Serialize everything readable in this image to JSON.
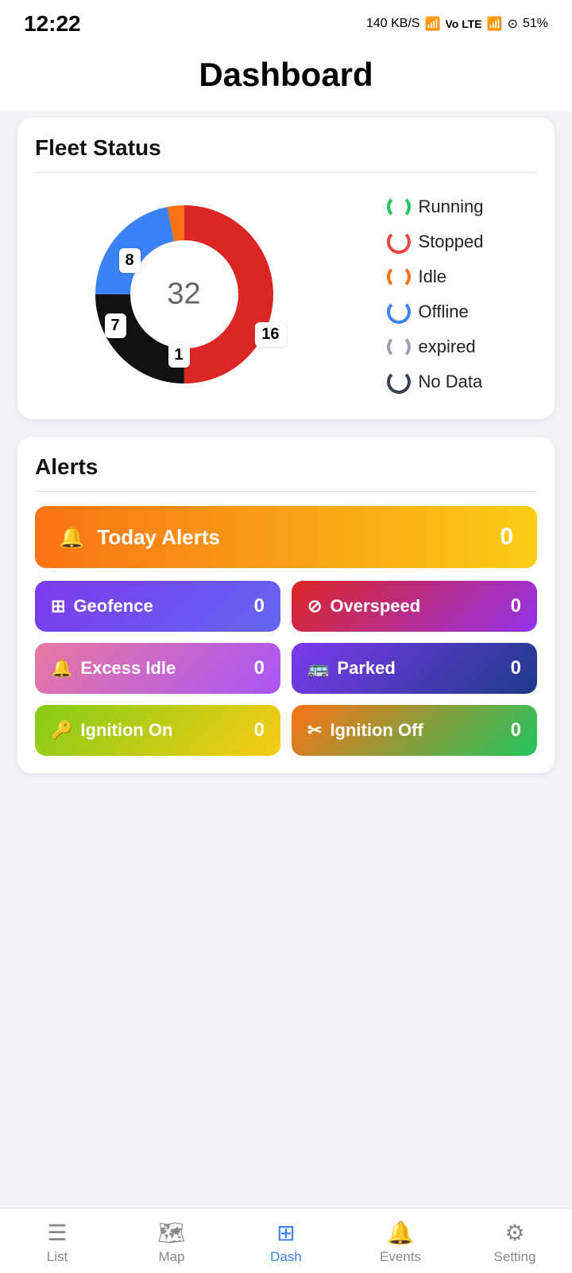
{
  "statusBar": {
    "time": "12:22",
    "networkSpeed": "140 KB/S",
    "battery": "51%"
  },
  "header": {
    "title": "Dashboard"
  },
  "fleetStatus": {
    "cardTitle": "Fleet Status",
    "totalVehicles": "32",
    "segments": [
      {
        "label": "Running",
        "value": 16,
        "color": "#dc2626",
        "legendClass": "spinner-running"
      },
      {
        "label": "Stopped",
        "value": 8,
        "color": "#111111",
        "legendClass": "spinner-stopped"
      },
      {
        "label": "Idle",
        "value": 1,
        "color": "#f97316",
        "legendClass": "spinner-idle"
      },
      {
        "label": "Offline",
        "value": 7,
        "color": "#3b82f6",
        "legendClass": "spinner-offline"
      },
      {
        "label": "expired",
        "value": 0,
        "color": "#9ca3af",
        "legendClass": "spinner-expired"
      },
      {
        "label": "No Data",
        "value": 0,
        "color": "#374151",
        "legendClass": "spinner-nodata"
      }
    ],
    "labels": [
      {
        "text": "8",
        "class": "label-8"
      },
      {
        "text": "16",
        "class": "label-16"
      },
      {
        "text": "7",
        "class": "label-7"
      },
      {
        "text": "1",
        "class": "label-1"
      }
    ]
  },
  "alerts": {
    "cardTitle": "Alerts",
    "todayAlerts": {
      "label": "Today Alerts",
      "count": "0"
    },
    "buttons": [
      {
        "id": "geofence",
        "label": "Geofence",
        "count": "0",
        "icon": "⊞",
        "class": "geofence-btn"
      },
      {
        "id": "overspeed",
        "label": "Overspeed",
        "count": "0",
        "icon": "⊘",
        "class": "overspeed-btn"
      },
      {
        "id": "excessidle",
        "label": "Excess Idle",
        "count": "0",
        "icon": "🔔",
        "class": "excess-idle-btn"
      },
      {
        "id": "parked",
        "label": "Parked",
        "count": "0",
        "icon": "🚌",
        "class": "parked-btn"
      },
      {
        "id": "ignitionon",
        "label": "Ignition On",
        "count": "0",
        "icon": "🔑",
        "class": "ignition-on-btn"
      },
      {
        "id": "ignitionoff",
        "label": "Ignition Off",
        "count": "0",
        "icon": "✂",
        "class": "ignition-off-btn"
      }
    ]
  },
  "bottomNav": {
    "items": [
      {
        "id": "list",
        "label": "List",
        "icon": "☰",
        "active": false
      },
      {
        "id": "map",
        "label": "Map",
        "icon": "🗺",
        "active": false
      },
      {
        "id": "dash",
        "label": "Dash",
        "icon": "⊞",
        "active": true
      },
      {
        "id": "events",
        "label": "Events",
        "icon": "🔔",
        "active": false
      },
      {
        "id": "setting",
        "label": "Setting",
        "icon": "⚙",
        "active": false
      }
    ]
  }
}
